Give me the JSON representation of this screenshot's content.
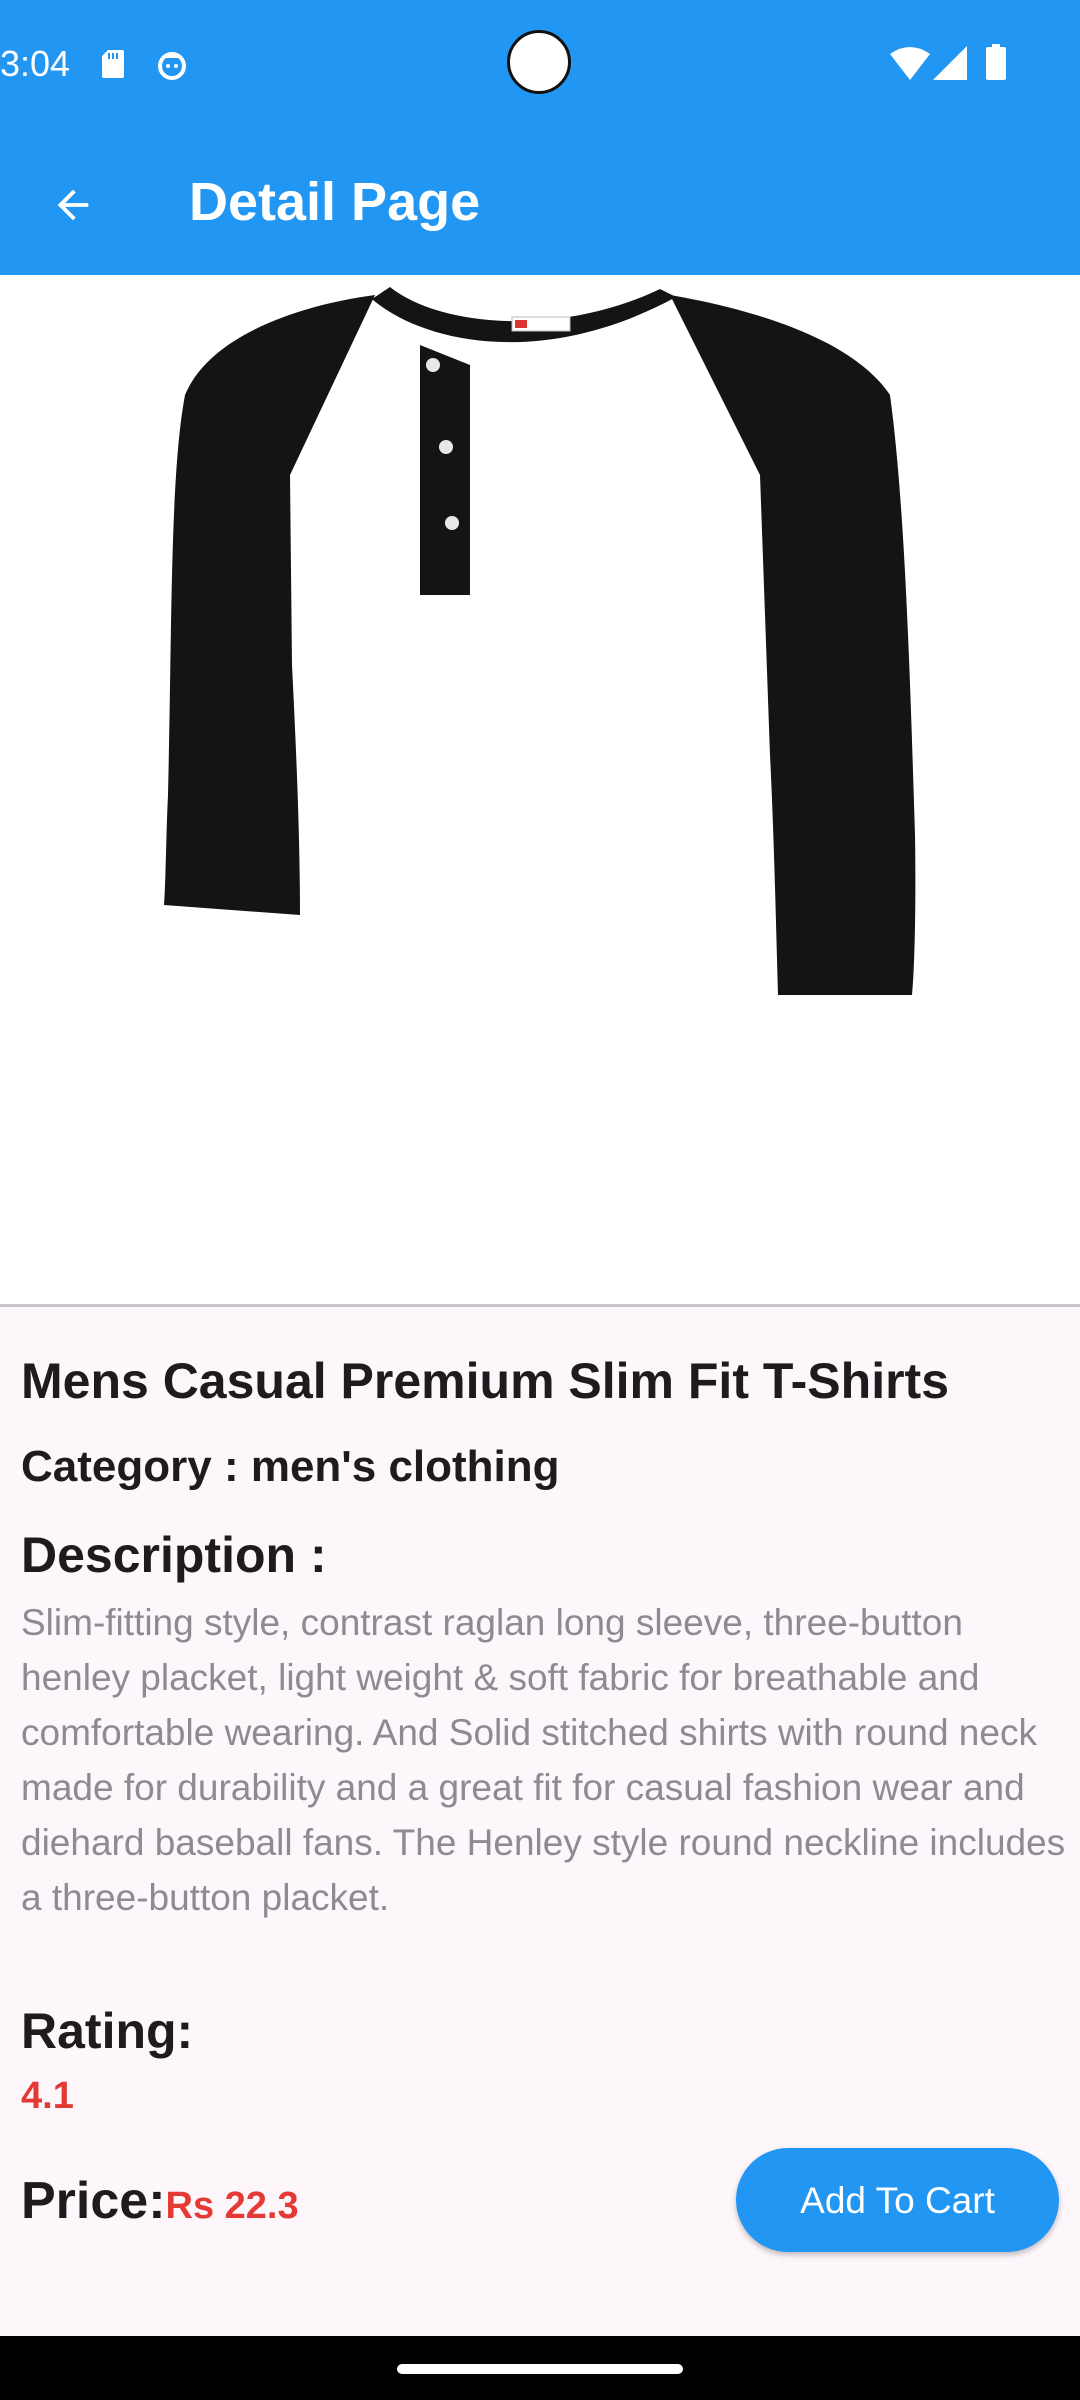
{
  "status_bar": {
    "time": "3:04",
    "icons": [
      "sd-card-icon",
      "face-icon",
      "wifi-icon",
      "signal-icon",
      "battery-icon"
    ]
  },
  "app_bar": {
    "title": "Detail Page",
    "back_icon": "arrow-back-icon"
  },
  "product": {
    "image": "product-image-henley-tshirt",
    "title": "Mens Casual Premium Slim Fit T-Shirts",
    "category": "Category : men's clothing",
    "description_label": "Description :",
    "description": "Slim-fitting style, contrast raglan long sleeve, three-button henley placket, light weight & soft fabric for breathable and comfortable wearing. And Solid stitched shirts with round neck made for durability and a great fit for casual fashion wear and diehard baseball fans. The Henley style round neckline includes a three-button placket.",
    "rating_label": "Rating:",
    "rating_value": "4.1",
    "price_label": "Price:",
    "price_value": "Rs 22.3",
    "add_to_cart_label": "Add To Cart"
  },
  "colors": {
    "primary": "#2196F3",
    "background": "#FDF7FC",
    "accent_red": "#E53935",
    "description_gray": "#8E8A90"
  }
}
